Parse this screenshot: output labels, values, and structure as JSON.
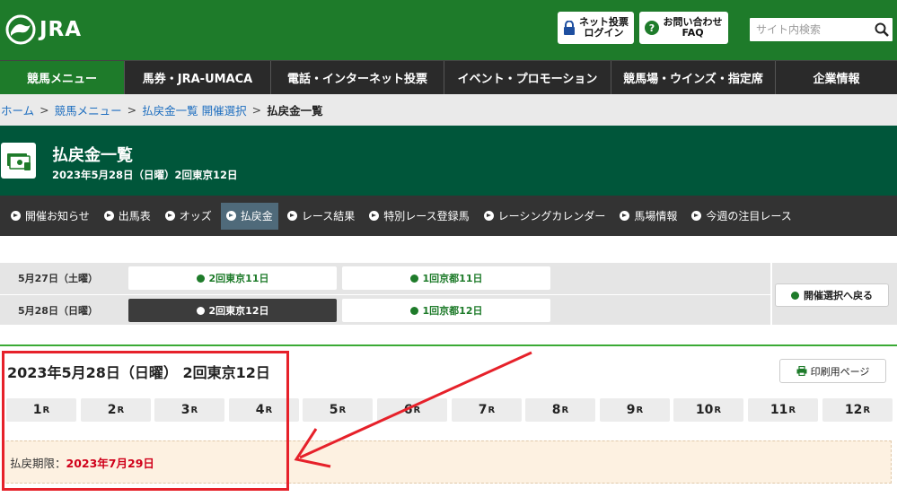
{
  "header": {
    "logo_text": "JRA",
    "login_line1": "ネット投票",
    "login_line2": "ログイン",
    "faq_line1": "お問い合わせ",
    "faq_line2": "FAQ",
    "search_placeholder": "サイト内検索"
  },
  "gnav": {
    "items": [
      "競馬メニュー",
      "馬券・JRA-UMACA",
      "電話・インターネット投票",
      "イベント・プロモーション",
      "競馬場・ウインズ・指定席",
      "企業情報"
    ]
  },
  "breadcrumb": {
    "home": "ホーム",
    "menu": "競馬メニュー",
    "select": "払戻金一覧 開催選択",
    "sep": ">",
    "current": "払戻金一覧"
  },
  "title": {
    "heading": "払戻金一覧",
    "subtitle": "2023年5月28日（日曜）2回東京12日"
  },
  "subnav": {
    "items": [
      "開催お知らせ",
      "出馬表",
      "オッズ",
      "払戻金",
      "レース結果",
      "特別レース登録馬",
      "レーシングカレンダー",
      "馬場情報",
      "今週の注目レース"
    ],
    "active_index": 3
  },
  "date_select": {
    "rows": [
      {
        "date": "5月27日（土曜）",
        "buttons": [
          "2回東京11日",
          "1回京都11日"
        ]
      },
      {
        "date": "5月28日（日曜）",
        "buttons": [
          "2回東京12日",
          "1回京都12日"
        ]
      }
    ],
    "selected": "2回東京12日",
    "back_label": "開催選択へ戻る"
  },
  "race": {
    "header": "2023年5月28日（日曜） 2回東京12日",
    "print_label": "印刷用ページ",
    "tabs": [
      "1",
      "2",
      "3",
      "4",
      "5",
      "6",
      "7",
      "8",
      "9",
      "10",
      "11",
      "12"
    ],
    "tab_suffix": "R",
    "deadline_label": "払戻期限：",
    "deadline_value": "2023年7月29日"
  },
  "colors": {
    "brand_green": "#1e7b2a",
    "dark_green": "#00563a",
    "annotation_red": "#e6212a",
    "deadline_red": "#d0001a"
  }
}
